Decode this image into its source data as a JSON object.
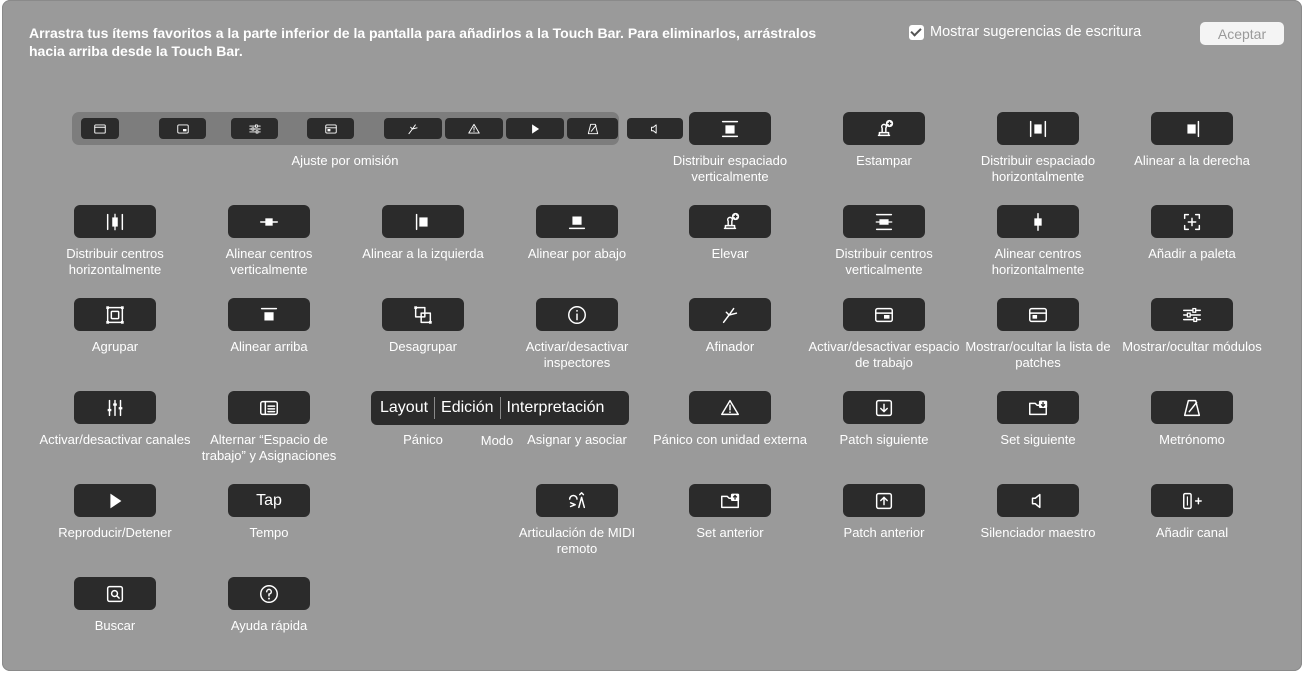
{
  "instructions": "Arrastra tus ítems favoritos a la parte inferior de la pantalla para añadirlos a la Touch Bar. Para eliminarlos, arrástralos hacia arriba desde la Touch Bar.",
  "suggestions_label": "Mostrar sugerencias de escritura",
  "suggestions_checked": true,
  "accept_label": "Aceptar",
  "default_set_label": "Ajuste por omisión",
  "default_set_icons": [
    "window-icon",
    "screen-icon",
    "sliders-icon",
    "layout-icon",
    "tuner-icon",
    "warning-icon",
    "play-icon",
    "metronome-icon",
    "speaker-icon"
  ],
  "items": [
    {
      "label": "Distribuir espaciado verticalmente",
      "icon": "distribute-vertical-spacing-icon"
    },
    {
      "label": "Estampar",
      "icon": "stamp-icon"
    },
    {
      "label": "Distribuir espaciado horizontalmente",
      "icon": "distribute-horizontal-spacing-icon"
    },
    {
      "label": "Alinear a la derecha",
      "icon": "align-right-icon"
    },
    {
      "label": "Distribuir centros horizontalmente",
      "icon": "distribute-centers-horizontal-icon"
    },
    {
      "label": "Alinear centros verticalmente",
      "icon": "align-centers-vertical-icon"
    },
    {
      "label": "Alinear a la izquierda",
      "icon": "align-left-icon"
    },
    {
      "label": "Alinear por abajo",
      "icon": "align-bottom-icon"
    },
    {
      "label": "Elevar",
      "icon": "raise-icon"
    },
    {
      "label": "Distribuir centros verticalmente",
      "icon": "distribute-centers-vertical-icon"
    },
    {
      "label": "Alinear centros horizontalmente",
      "icon": "align-centers-horizontal-icon"
    },
    {
      "label": "Añadir a paleta",
      "icon": "add-to-palette-icon"
    },
    {
      "label": "Agrupar",
      "icon": "group-icon"
    },
    {
      "label": "Alinear arriba",
      "icon": "align-top-icon"
    },
    {
      "label": "Desagrupar",
      "icon": "ungroup-icon"
    },
    {
      "label": "Activar/desactivar inspectores",
      "icon": "info-icon"
    },
    {
      "label": "Afinador",
      "icon": "tuner-icon"
    },
    {
      "label": "Activar/desactivar espacio de trabajo",
      "icon": "workspace-icon"
    },
    {
      "label": "Mostrar/ocultar la lista de patches",
      "icon": "patch-list-icon"
    },
    {
      "label": "Mostrar/ocultar módulos",
      "icon": "sliders-icon"
    },
    {
      "label": "Activar/desactivar canales",
      "icon": "channel-faders-icon"
    },
    {
      "label": "Alternar “Espacio de trabajo” y Asignaciones",
      "icon": "workspace-assignments-icon"
    },
    {
      "label": "Pánico",
      "icon": "warning-icon"
    },
    {
      "label": "Asignar y asociar",
      "icon": "assign-map-icon"
    },
    {
      "label": "Pánico con unidad externa",
      "icon": "warning-icon"
    },
    {
      "label": "Patch siguiente",
      "icon": "arrow-down-box-icon"
    },
    {
      "label": "Set siguiente",
      "icon": "folder-down-icon"
    },
    {
      "label": "Metrónomo",
      "icon": "metronome-icon"
    },
    {
      "label": "Reproducir/Detener",
      "icon": "play-icon"
    },
    {
      "label": "Tempo",
      "icon": "tap-text",
      "text": "Tap"
    },
    {
      "label": "Articulación de MIDI remoto",
      "icon": "midi-articulation-icon"
    },
    {
      "label": "Set anterior",
      "icon": "folder-up-icon"
    },
    {
      "label": "Patch anterior",
      "icon": "arrow-up-box-icon"
    },
    {
      "label": "Silenciador maestro",
      "icon": "speaker-icon"
    },
    {
      "label": "Añadir canal",
      "icon": "add-channel-icon"
    },
    {
      "label": "Buscar",
      "icon": "search-icon"
    },
    {
      "label": "Ayuda rápida",
      "icon": "help-icon"
    }
  ],
  "mode": {
    "label": "Modo",
    "segments": [
      "Layout",
      "Edición",
      "Interpretación"
    ]
  }
}
